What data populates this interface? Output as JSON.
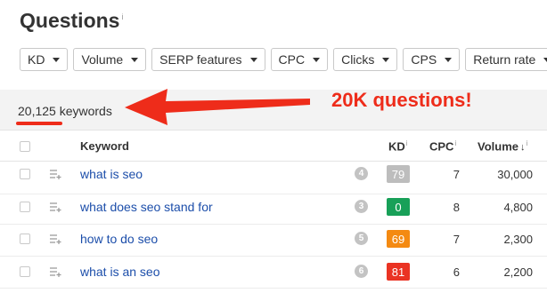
{
  "page": {
    "title": "Questions",
    "title_info": "i"
  },
  "filters": [
    {
      "label": "KD"
    },
    {
      "label": "Volume"
    },
    {
      "label": "SERP features"
    },
    {
      "label": "CPC"
    },
    {
      "label": "Clicks"
    },
    {
      "label": "CPS"
    },
    {
      "label": "Return rate"
    }
  ],
  "summary": {
    "count_text": "20,125 keywords",
    "annotation": "20K questions!",
    "annotation_color": "#ee2c1a"
  },
  "table": {
    "headers": {
      "keyword": "Keyword",
      "kd": "KD",
      "kd_info": "i",
      "cpc": "CPC",
      "cpc_info": "i",
      "volume": "Volume",
      "volume_sort": "↓",
      "volume_info": "i"
    },
    "rows": [
      {
        "keyword": "what is seo",
        "serp_count": "4",
        "kd": "79",
        "kd_color": "#bdbdbd",
        "cpc": "7",
        "volume": "30,000"
      },
      {
        "keyword": "what does seo stand for",
        "serp_count": "3",
        "kd": "0",
        "kd_color": "#18a058",
        "cpc": "8",
        "volume": "4,800"
      },
      {
        "keyword": "how to do seo",
        "serp_count": "5",
        "kd": "69",
        "kd_color": "#f48a12",
        "cpc": "7",
        "volume": "2,300"
      },
      {
        "keyword": "what is an seo",
        "serp_count": "6",
        "kd": "81",
        "kd_color": "#ea3323",
        "cpc": "6",
        "volume": "2,200"
      }
    ]
  },
  "icons": {
    "caret": "chevron-down-icon",
    "add_to_list": "add-to-list-icon",
    "arrow": "red-arrow-annotation"
  }
}
